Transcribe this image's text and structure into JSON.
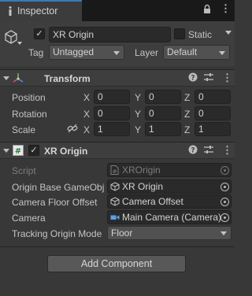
{
  "tab": {
    "title": "Inspector"
  },
  "gameobject": {
    "name": "XR Origin",
    "active": true,
    "static_label": "Static",
    "tag_label": "Tag",
    "tag_value": "Untagged",
    "layer_label": "Layer",
    "layer_value": "Default"
  },
  "transform": {
    "title": "Transform",
    "rows": [
      {
        "label": "Position",
        "x": "0",
        "y": "0",
        "z": "0"
      },
      {
        "label": "Rotation",
        "x": "0",
        "y": "0",
        "z": "0"
      },
      {
        "label": "Scale",
        "x": "1",
        "y": "1",
        "z": "1"
      }
    ],
    "axis_x": "X",
    "axis_y": "Y",
    "axis_z": "Z"
  },
  "xr_origin": {
    "title": "XR Origin",
    "enabled": true,
    "fields": [
      {
        "label": "Script",
        "value": "XROrigin",
        "icon": "script-icon"
      },
      {
        "label": "Origin Base GameObj",
        "value": "XR Origin",
        "icon": "gameobject-icon"
      },
      {
        "label": "Camera Floor Offset",
        "value": "Camera Offset",
        "icon": "gameobject-icon"
      },
      {
        "label": "Camera",
        "value": "Main Camera (Camera)",
        "icon": "camera-icon"
      },
      {
        "label": "Tracking Origin Mode",
        "value": "Floor",
        "icon": "dropdown"
      }
    ]
  },
  "add_component": {
    "label": "Add Component"
  },
  "colors": {
    "accent": "#3a79bb",
    "background": "#383838",
    "header": "#3e3e3e"
  }
}
